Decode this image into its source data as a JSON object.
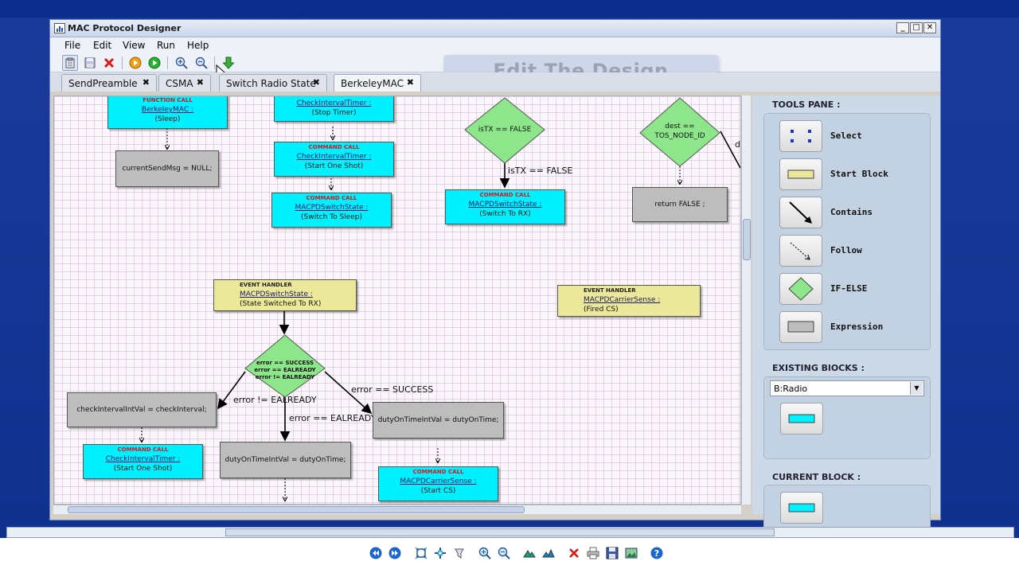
{
  "window": {
    "title": "MAC Protocol Designer",
    "min_label": "_",
    "max_label": "□",
    "close_label": "✕"
  },
  "menu": {
    "file": "File",
    "edit": "Edit",
    "view": "View",
    "run": "Run",
    "help": "Help"
  },
  "caption": "Edit The Design",
  "tabs": [
    {
      "label": "SendPreamble",
      "close": "✖"
    },
    {
      "label": "CSMA",
      "close": "✖"
    },
    {
      "label": "Switch Radio State",
      "close": "✖"
    },
    {
      "label": "BerkeleyMAC",
      "close": "✖"
    }
  ],
  "diagram": {
    "b1": {
      "hdr": "FUNCTION CALL",
      "name": "BerkeleyMAC :",
      "arg": "(Sleep)"
    },
    "b2": {
      "text": "currentSendMsg = NULL;"
    },
    "b3": {
      "name": "CheckIntervalTimer :",
      "arg": "(Stop Timer)"
    },
    "b4": {
      "hdr": "COMMAND CALL",
      "name": "CheckIntervalTimer :",
      "arg": "(Start One Shot)"
    },
    "b5": {
      "hdr": "COMMAND CALL",
      "name": "MACPDSwitchState :",
      "arg": "(Switch To Sleep)"
    },
    "d1": {
      "text": "isTX == FALSE"
    },
    "e1": "isTX == FALSE",
    "b6": {
      "hdr": "COMMAND CALL",
      "name": "MACPDSwitchState :",
      "arg": "(Switch To RX)"
    },
    "d2": {
      "line1": "dest ==",
      "line2": "TOS_NODE_ID"
    },
    "e2": "d",
    "b7": {
      "text": "return FALSE ;"
    },
    "b8": {
      "hdr": "EVENT HANDLER",
      "name": "MACPDSwitchState :",
      "arg": "(State Switched To RX)"
    },
    "b9": {
      "hdr": "EVENT HANDLER",
      "name": "MACPDCarrierSense :",
      "arg": "(Fired CS)"
    },
    "d3": {
      "line1": "error == SUCCESS",
      "line2": "error == EALREADY",
      "line3": "error != EALREADY"
    },
    "e3": "error != EALREADY",
    "e4": "error == EALREADY",
    "e5": "error == SUCCESS",
    "b10": {
      "text": "checkIntervalIntVal = checkInterval;"
    },
    "b11": {
      "text": "dutyOnTimeIntVal = dutyOnTime;"
    },
    "b12": {
      "text": "dutyOnTimeIntVal = dutyOnTime;"
    },
    "b13": {
      "hdr": "COMMAND CALL",
      "name": "CheckIntervalTimer :",
      "arg": "(Start One Shot)"
    },
    "b14": {
      "hdr": "COMMAND CALL",
      "name": "MACPDCarrierSense :",
      "arg": "(Start CS)"
    }
  },
  "tools_pane": {
    "title": "TOOLS PANE :",
    "tools": [
      {
        "label": "Select",
        "icon": "select-icon"
      },
      {
        "label": "Start Block",
        "icon": "start-block-icon"
      },
      {
        "label": "Contains",
        "icon": "contains-arrow-icon"
      },
      {
        "label": "Follow",
        "icon": "follow-arrow-icon"
      },
      {
        "label": "IF-ELSE",
        "icon": "if-else-diamond-icon"
      },
      {
        "label": "Expression",
        "icon": "expression-block-icon"
      }
    ],
    "existing_title": "EXISTING BlOCKS :",
    "existing_selected": "B:Radio",
    "current_title": "CURRENT BLOCK :"
  },
  "colors": {
    "command_block": "#00f0ff",
    "event_block": "#ece89a",
    "expression_block": "#bdbdbd",
    "decision": "#8ee68a",
    "header_red": "#e0141e"
  }
}
